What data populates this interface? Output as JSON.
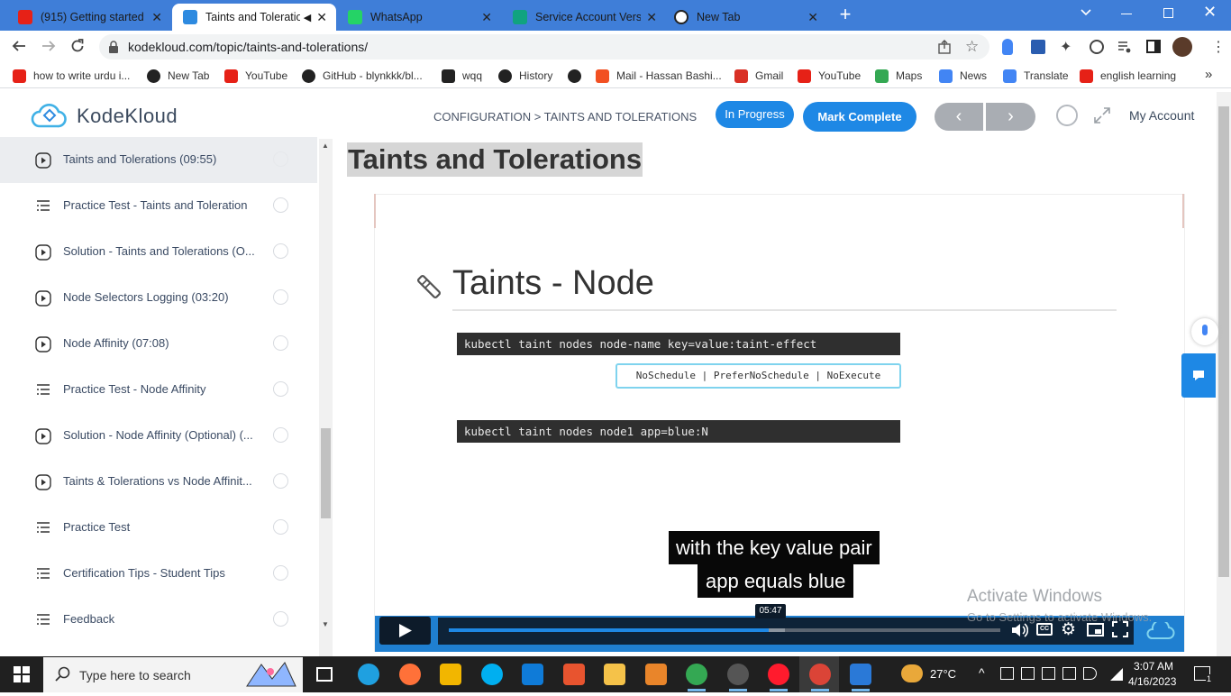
{
  "browser": {
    "tabs": [
      {
        "title": "(915) Getting started w",
        "favicon": "youtube-icon",
        "color": "#e62117"
      },
      {
        "title": "Taints and Toleratio",
        "favicon": "kodekloud-icon",
        "color": "#2d8ae0"
      },
      {
        "title": "WhatsApp",
        "favicon": "whatsapp-icon",
        "color": "#25d366"
      },
      {
        "title": "Service Account Versio",
        "favicon": "chatgpt-icon",
        "color": "#10a37f"
      },
      {
        "title": "New Tab",
        "favicon": "chrome-icon",
        "color": "#333333"
      }
    ],
    "address": "kodekloud.com/topic/taints-and-tolerations/",
    "bookmarks": [
      {
        "label": "how to write urdu i...",
        "icon": "youtube-icon",
        "color": "#e62117"
      },
      {
        "label": "New Tab",
        "icon": "globe-icon",
        "color": "#222222"
      },
      {
        "label": "YouTube",
        "icon": "youtube-icon",
        "color": "#e62117"
      },
      {
        "label": "GitHub - blynkkk/bl...",
        "icon": "github-icon",
        "color": "#222222"
      },
      {
        "label": "wqq",
        "icon": "download-icon",
        "color": "#222222"
      },
      {
        "label": "History",
        "icon": "history-icon",
        "color": "#222222"
      },
      {
        "label": "",
        "icon": "globe-icon",
        "color": "#222222"
      },
      {
        "label": "Mail - Hassan Bashi...",
        "icon": "microsoft-icon",
        "color": "#f25022"
      },
      {
        "label": "Gmail",
        "icon": "gmail-icon",
        "color": "#d93025"
      },
      {
        "label": "YouTube",
        "icon": "youtube-icon",
        "color": "#e62117"
      },
      {
        "label": "Maps",
        "icon": "maps-icon",
        "color": "#34a853"
      },
      {
        "label": "News",
        "icon": "news-icon",
        "color": "#4285f4"
      },
      {
        "label": "Translate",
        "icon": "translate-icon",
        "color": "#4285f4"
      },
      {
        "label": "english learning",
        "icon": "youtube-icon",
        "color": "#e62117"
      }
    ]
  },
  "header": {
    "logo": "KodeKloud",
    "breadcrumb": "CONFIGURATION > TAINTS AND TOLERATIONS",
    "status": "In Progress",
    "mark_complete": "Mark Complete",
    "prev": "‹",
    "next": "›",
    "account": "My Account",
    "accent": "#1e88e5"
  },
  "sidebar": {
    "items": [
      {
        "label": "Taints and Tolerations (09:55)",
        "type": "video",
        "active": true
      },
      {
        "label": "Practice Test - Taints and Toleration",
        "type": "lab"
      },
      {
        "label": "Solution - Taints and Tolerations (O...",
        "type": "video"
      },
      {
        "label": "Node Selectors Logging (03:20)",
        "type": "video"
      },
      {
        "label": "Node Affinity (07:08)",
        "type": "video"
      },
      {
        "label": "Practice Test - Node Affinity",
        "type": "lab"
      },
      {
        "label": "Solution - Node Affinity (Optional) (...",
        "type": "video"
      },
      {
        "label": "Taints & Tolerations vs Node Affinit...",
        "type": "video"
      },
      {
        "label": "Practice Test",
        "type": "lab"
      },
      {
        "label": "Certification Tips - Student Tips",
        "type": "lab"
      },
      {
        "label": "Feedback",
        "type": "lab"
      }
    ]
  },
  "lesson": {
    "title": "Taints and Tolerations",
    "slide": {
      "heading": "Taints - Node",
      "cmd1": "kubectl taint nodes node-name key=value:taint-effect",
      "effects": "NoSchedule | PreferNoSchedule | NoExecute",
      "cmd2": "kubectl taint nodes node1 app=blue:N"
    },
    "caption_line1": "with the key value pair",
    "caption_line2": "app equals blue",
    "time": "05:47",
    "progress": 0.58,
    "buffered": 0.61
  },
  "watermark": {
    "line1": "Activate Windows",
    "line2": "Go to Settings to activate Windows."
  },
  "taskbar": {
    "search": "Type here to search",
    "weather": "27°C",
    "time": "3:07 AM",
    "date": "4/16/2023",
    "notif": "1"
  }
}
